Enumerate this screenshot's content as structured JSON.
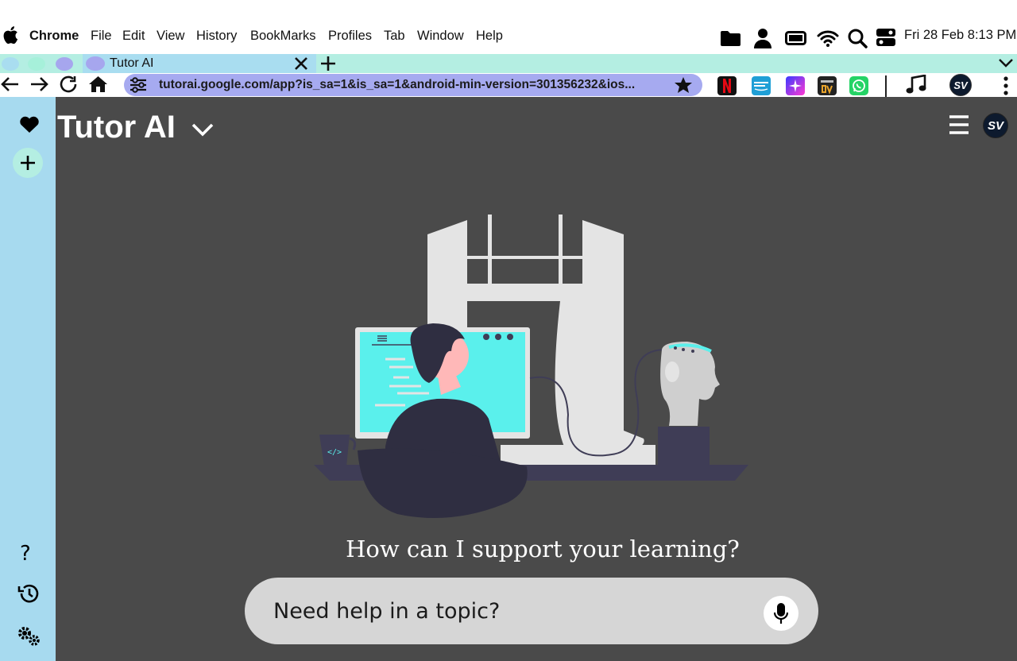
{
  "menubar": {
    "app_name": "Chrome",
    "items": [
      "File",
      "Edit",
      "View",
      "History",
      "BookMarks",
      "Profiles",
      "Tab",
      "Window",
      "Help"
    ],
    "clock": "Fri 28 Feb  8:13 PM"
  },
  "tab": {
    "title": "Tutor AI"
  },
  "address_bar": {
    "url": "tutorai.google.com/app?is_sa=1&is_sa=1&android-min-version=301356232&ios..."
  },
  "extensions": [
    "netflix",
    "prime-video",
    "spark",
    "sony-liv",
    "whatsapp"
  ],
  "profile_initials": "SV",
  "app": {
    "title": "Tutor AI",
    "prompt_heading": "How can I support your learning?",
    "search": {
      "placeholder": "Need help in a topic?",
      "value": ""
    }
  },
  "colors": {
    "sidebar": "#a7daef",
    "main_bg": "#4a4a4a",
    "tabstrip": "#b4eee2",
    "active_tab": "#a9ddf0",
    "omnibox": "#a6aaf0",
    "screen_accent": "#5af0ec"
  }
}
